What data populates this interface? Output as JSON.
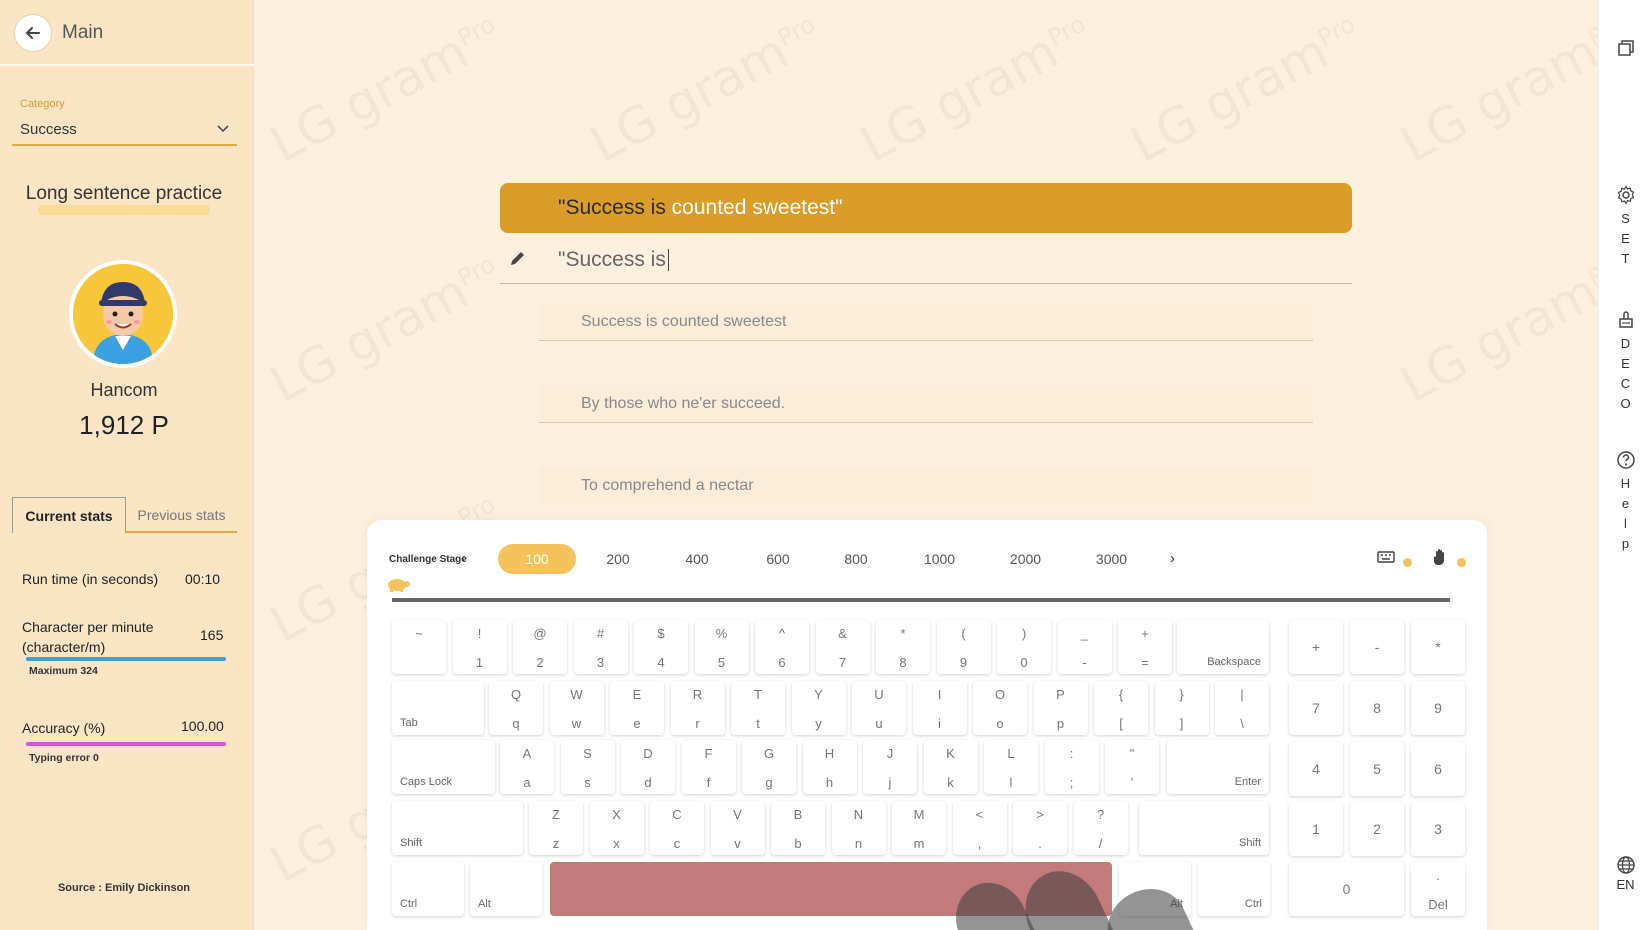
{
  "header": {
    "title": "Main"
  },
  "category": {
    "label": "Category",
    "value": "Success"
  },
  "practice_title": "Long sentence practice",
  "user": {
    "name": "Hancom",
    "points": "1,912 P"
  },
  "stats": {
    "tab_current": "Current stats",
    "tab_previous": "Previous stats",
    "run_time_label": "Run time (in seconds)",
    "run_time_value": "00:10",
    "cpm_label": "Character per minute (character/m)",
    "cpm_value": "165",
    "cpm_max": "Maximum 324",
    "accuracy_label": "Accuracy (%)",
    "accuracy_value": "100.00",
    "typing_error": "Typing error 0"
  },
  "source": "Source : Emily Dickinson",
  "target": {
    "typed_part": "\"Success is ",
    "remaining_part": "counted sweetest\""
  },
  "input": {
    "value": "\"Success is"
  },
  "next_lines": [
    "Success is counted sweetest",
    "By those who ne'er succeed.",
    "To comprehend a nectar"
  ],
  "challenge": {
    "label": "Challenge Stage",
    "stages": [
      "100",
      "200",
      "400",
      "600",
      "800",
      "1000",
      "2000",
      "3000"
    ],
    "active": "100"
  },
  "rail": {
    "set": [
      "S",
      "E",
      "T"
    ],
    "deco": [
      "D",
      "E",
      "C",
      "O"
    ],
    "help": [
      "H",
      "e",
      "l",
      "p"
    ],
    "lang": "EN"
  },
  "watermark": {
    "brand": "LG gram",
    "sup": "Pro"
  },
  "keyboard": {
    "row1": [
      [
        "~",
        ""
      ],
      [
        "!",
        "1"
      ],
      [
        "@",
        "2"
      ],
      [
        "#",
        "3"
      ],
      [
        "$",
        "4"
      ],
      [
        "%",
        "5"
      ],
      [
        "^",
        "6"
      ],
      [
        "&",
        "7"
      ],
      [
        "*",
        "8"
      ],
      [
        "(",
        "9"
      ],
      [
        ")",
        "0"
      ],
      [
        "_",
        "-"
      ],
      [
        "+",
        "="
      ]
    ],
    "backspace": "Backspace",
    "tab": "Tab",
    "row2": [
      [
        "Q",
        "q"
      ],
      [
        "W",
        "w"
      ],
      [
        "E",
        "e"
      ],
      [
        "R",
        "r"
      ],
      [
        "T",
        "t"
      ],
      [
        "Y",
        "y"
      ],
      [
        "U",
        "u"
      ],
      [
        "I",
        "i"
      ],
      [
        "O",
        "o"
      ],
      [
        "P",
        "p"
      ],
      [
        "{",
        "["
      ],
      [
        "}",
        "]"
      ],
      [
        "|",
        "\\"
      ]
    ],
    "caps": "Caps Lock",
    "row3": [
      [
        "A",
        "a"
      ],
      [
        "S",
        "s"
      ],
      [
        "D",
        "d"
      ],
      [
        "F",
        "f"
      ],
      [
        "G",
        "g"
      ],
      [
        "H",
        "h"
      ],
      [
        "J",
        "j"
      ],
      [
        "K",
        "k"
      ],
      [
        "L",
        "l"
      ],
      [
        ":",
        ";"
      ],
      [
        "\"",
        "'"
      ]
    ],
    "enter": "Enter",
    "shift": "Shift",
    "row4": [
      [
        "Z",
        "z"
      ],
      [
        "X",
        "x"
      ],
      [
        "C",
        "c"
      ],
      [
        "V",
        "v"
      ],
      [
        "B",
        "b"
      ],
      [
        "N",
        "n"
      ],
      [
        "M",
        "m"
      ],
      [
        "<",
        ","
      ],
      [
        ">",
        "."
      ],
      [
        "?",
        "/"
      ]
    ],
    "ctrl": "Ctrl",
    "alt": "Alt",
    "numpad_top": [
      "+",
      "-",
      "*"
    ],
    "numpad": [
      [
        "7",
        "8",
        "9"
      ],
      [
        "4",
        "5",
        "6"
      ],
      [
        "1",
        "2",
        "3"
      ]
    ],
    "zero": "0",
    "dot": ".",
    "del": "Del"
  },
  "colors": {
    "accent": "#dc9d28",
    "stage_active": "#f6c25c",
    "cpm_bar": "#3aa0e0",
    "accuracy_bar": "#e04fd8",
    "space": "#c27a7a"
  }
}
